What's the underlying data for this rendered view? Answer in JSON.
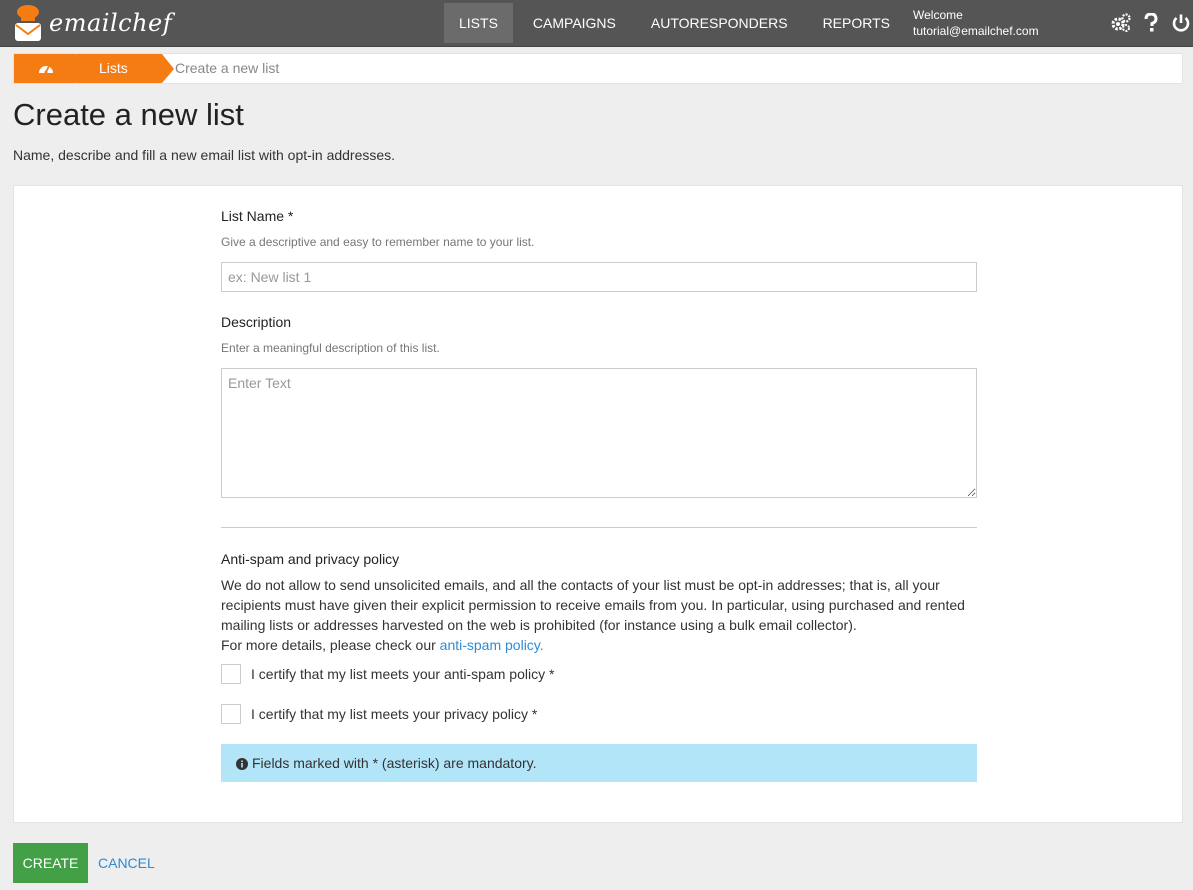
{
  "app": {
    "logo_text": "emailchef"
  },
  "nav": {
    "items": [
      {
        "label": "LISTS"
      },
      {
        "label": "CAMPAIGNS"
      },
      {
        "label": "AUTORESPONDERS"
      },
      {
        "label": "REPORTS"
      }
    ],
    "welcome_label": "Welcome",
    "user_email": "tutorial@emailchef.com",
    "icons": [
      "settings-gears-icon",
      "help-icon",
      "power-icon"
    ]
  },
  "breadcrumb": {
    "home_icon": "dashboard-icon",
    "lists_label": "Lists",
    "current_label": "Create a new list"
  },
  "page": {
    "title": "Create a new list",
    "subtitle": "Name, describe and fill a new email list with opt-in addresses."
  },
  "form": {
    "list_name": {
      "label": "List Name *",
      "help": "Give a descriptive and easy to remember name to your list.",
      "placeholder": "ex: New list 1",
      "value": ""
    },
    "description": {
      "label": "Description",
      "help": "Enter a meaningful description of this list.",
      "placeholder": "Enter Text",
      "value": ""
    },
    "policy": {
      "title": "Anti-spam and privacy policy",
      "body": "We do not allow to send unsolicited emails, and all the contacts of your list must be opt-in addresses; that is, all your recipients must have given their explicit permission to receive emails from you. In particular, using purchased and rented mailing lists or addresses harvested on the web is prohibited (for instance using a bulk email collector).",
      "details_prefix": "For more details, please check our ",
      "details_link": "anti-spam policy."
    },
    "checkboxes": [
      {
        "label": "I certify that my list meets your anti-spam policy *",
        "checked": false
      },
      {
        "label": "I certify that my list meets your privacy policy *",
        "checked": false
      }
    ],
    "info_note": "Fields marked with * (asterisk) are mandatory."
  },
  "actions": {
    "create_label": "CREATE",
    "cancel_label": "CANCEL"
  },
  "colors": {
    "topbar": "#555555",
    "accent_orange": "#f47c13",
    "create_green": "#43a047",
    "link_blue": "#2f8ad4",
    "info_bg": "#b3e5f9"
  }
}
